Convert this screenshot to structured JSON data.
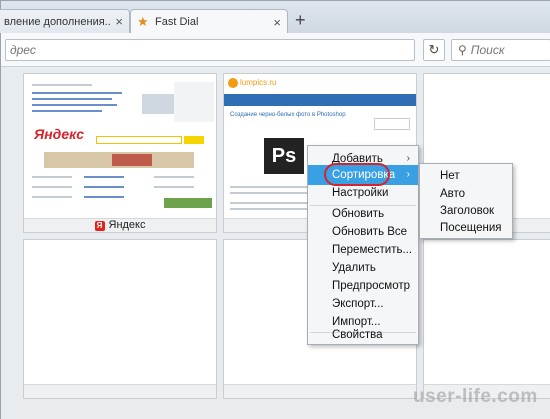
{
  "tabs": [
    {
      "title": "вление дополнения...",
      "active": false
    },
    {
      "title": "Fast Dial",
      "active": true
    }
  ],
  "toolbar": {
    "address_placeholder": "дрес",
    "search_placeholder": "Поиск"
  },
  "tiles": [
    {
      "caption": "Яндекс"
    },
    {
      "caption": ""
    },
    {
      "caption": ""
    },
    {
      "caption": ""
    },
    {
      "caption": ""
    },
    {
      "caption": ""
    }
  ],
  "thumb_text": {
    "lumpics_site": "lumpics.ru",
    "ps_logo": "Ps",
    "lumpics_heading": "Создание черно-белых фото в Photoshop"
  },
  "context_menu": {
    "items": [
      "Добавить",
      "Сортировка",
      "Настройки",
      "Обновить",
      "Обновить Все",
      "Переместить...",
      "Удалить",
      "Предпросмотр",
      "Экспорт...",
      "Импорт...",
      "Свойства"
    ]
  },
  "submenu": {
    "items": [
      "Нет",
      "Авто",
      "Заголовок",
      "Посещения"
    ]
  },
  "watermark": "user-life.com",
  "colors": {
    "highlight": "#3aa0e4",
    "ring": "#d6232c"
  }
}
